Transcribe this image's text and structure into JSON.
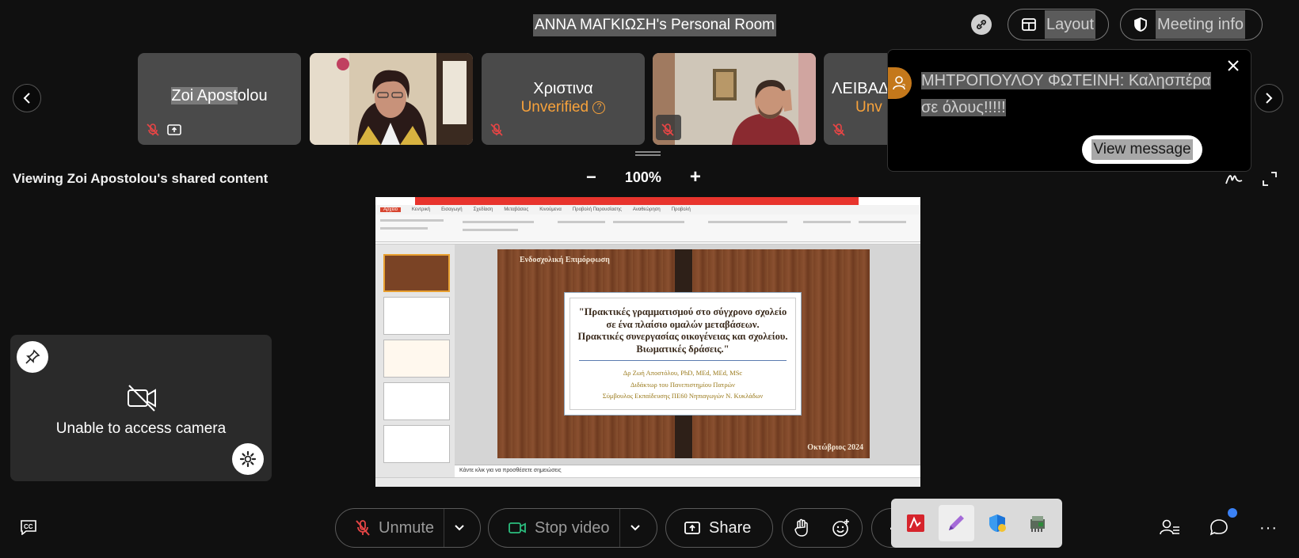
{
  "header": {
    "room_title": "ΑΝΝΑ ΜΑΓΚΙΩΣΗ's Personal Room",
    "layout_label": "Layout",
    "meeting_info_label": "Meeting info"
  },
  "participants": [
    {
      "name_part1": "Zoi Apost",
      "name_part2": "olou",
      "video": false
    },
    {
      "name": "",
      "video": true
    },
    {
      "name": "Χριστινα",
      "status": "Unverified",
      "video": false
    },
    {
      "name": "",
      "video": true
    },
    {
      "name": "ΛΕΙΒΑΔ",
      "status": "Unv",
      "video": false
    }
  ],
  "chat_toast": {
    "message_line1": "ΜΗΤΡΟΠΟΥΛΟΥ ΦΩΤΕΙΝΗ: Καλησπέρα",
    "message_line2": "σε όλους!!!!!",
    "view_label": "View message"
  },
  "share_bar": {
    "viewing_text": "Viewing Zoi Apostolou's shared content",
    "zoom_minus": "−",
    "zoom_level": "100%",
    "zoom_plus": "+"
  },
  "ppt": {
    "tabs": [
      "Αρχείο",
      "Κεντρική",
      "Εισαγωγή",
      "Σχεδίαση",
      "Μεταβάσεις",
      "Κινούμενα",
      "Προβολή Παρουσίασης",
      "Αναθεώρηση",
      "Προβολή"
    ],
    "slide": {
      "corner_top": "Ενδοσχολική Επιμόρφωση",
      "title_lines": [
        "\"Πρακτικές γραμματισμού στο σύγχρονο σχολείο",
        "σε ένα πλαίσιο ομαλών μεταβάσεων.",
        "Πρακτικές συνεργασίας οικογένειας και σχολείου.",
        "Βιωματικές δράσεις.\""
      ],
      "author_lines": [
        "Δρ Ζωή Αποστόλου, PhD, MEd, MEd, MSc",
        "Διδάκτωρ του Πανεπιστημίου Πατρών",
        "Σύμβουλος Εκπαίδευσης ΠΕ60 Νηπιαγωγών Ν. Κυκλάδων"
      ],
      "corner_bottom": "Οκτώβριος 2024"
    },
    "notes_placeholder": "Κάντε κλικ για να προσθέσετε σημειώσεις"
  },
  "self_view": {
    "message": "Unable to access camera"
  },
  "controls": {
    "unmute_label": "Unmute",
    "stop_video_label": "Stop video",
    "share_label": "Share"
  },
  "colors": {
    "background": "#101010",
    "unverified": "#f7a23b",
    "video_green": "#2bbd7e",
    "mute_red": "#e64545",
    "notification_blue": "#3b82f6"
  }
}
